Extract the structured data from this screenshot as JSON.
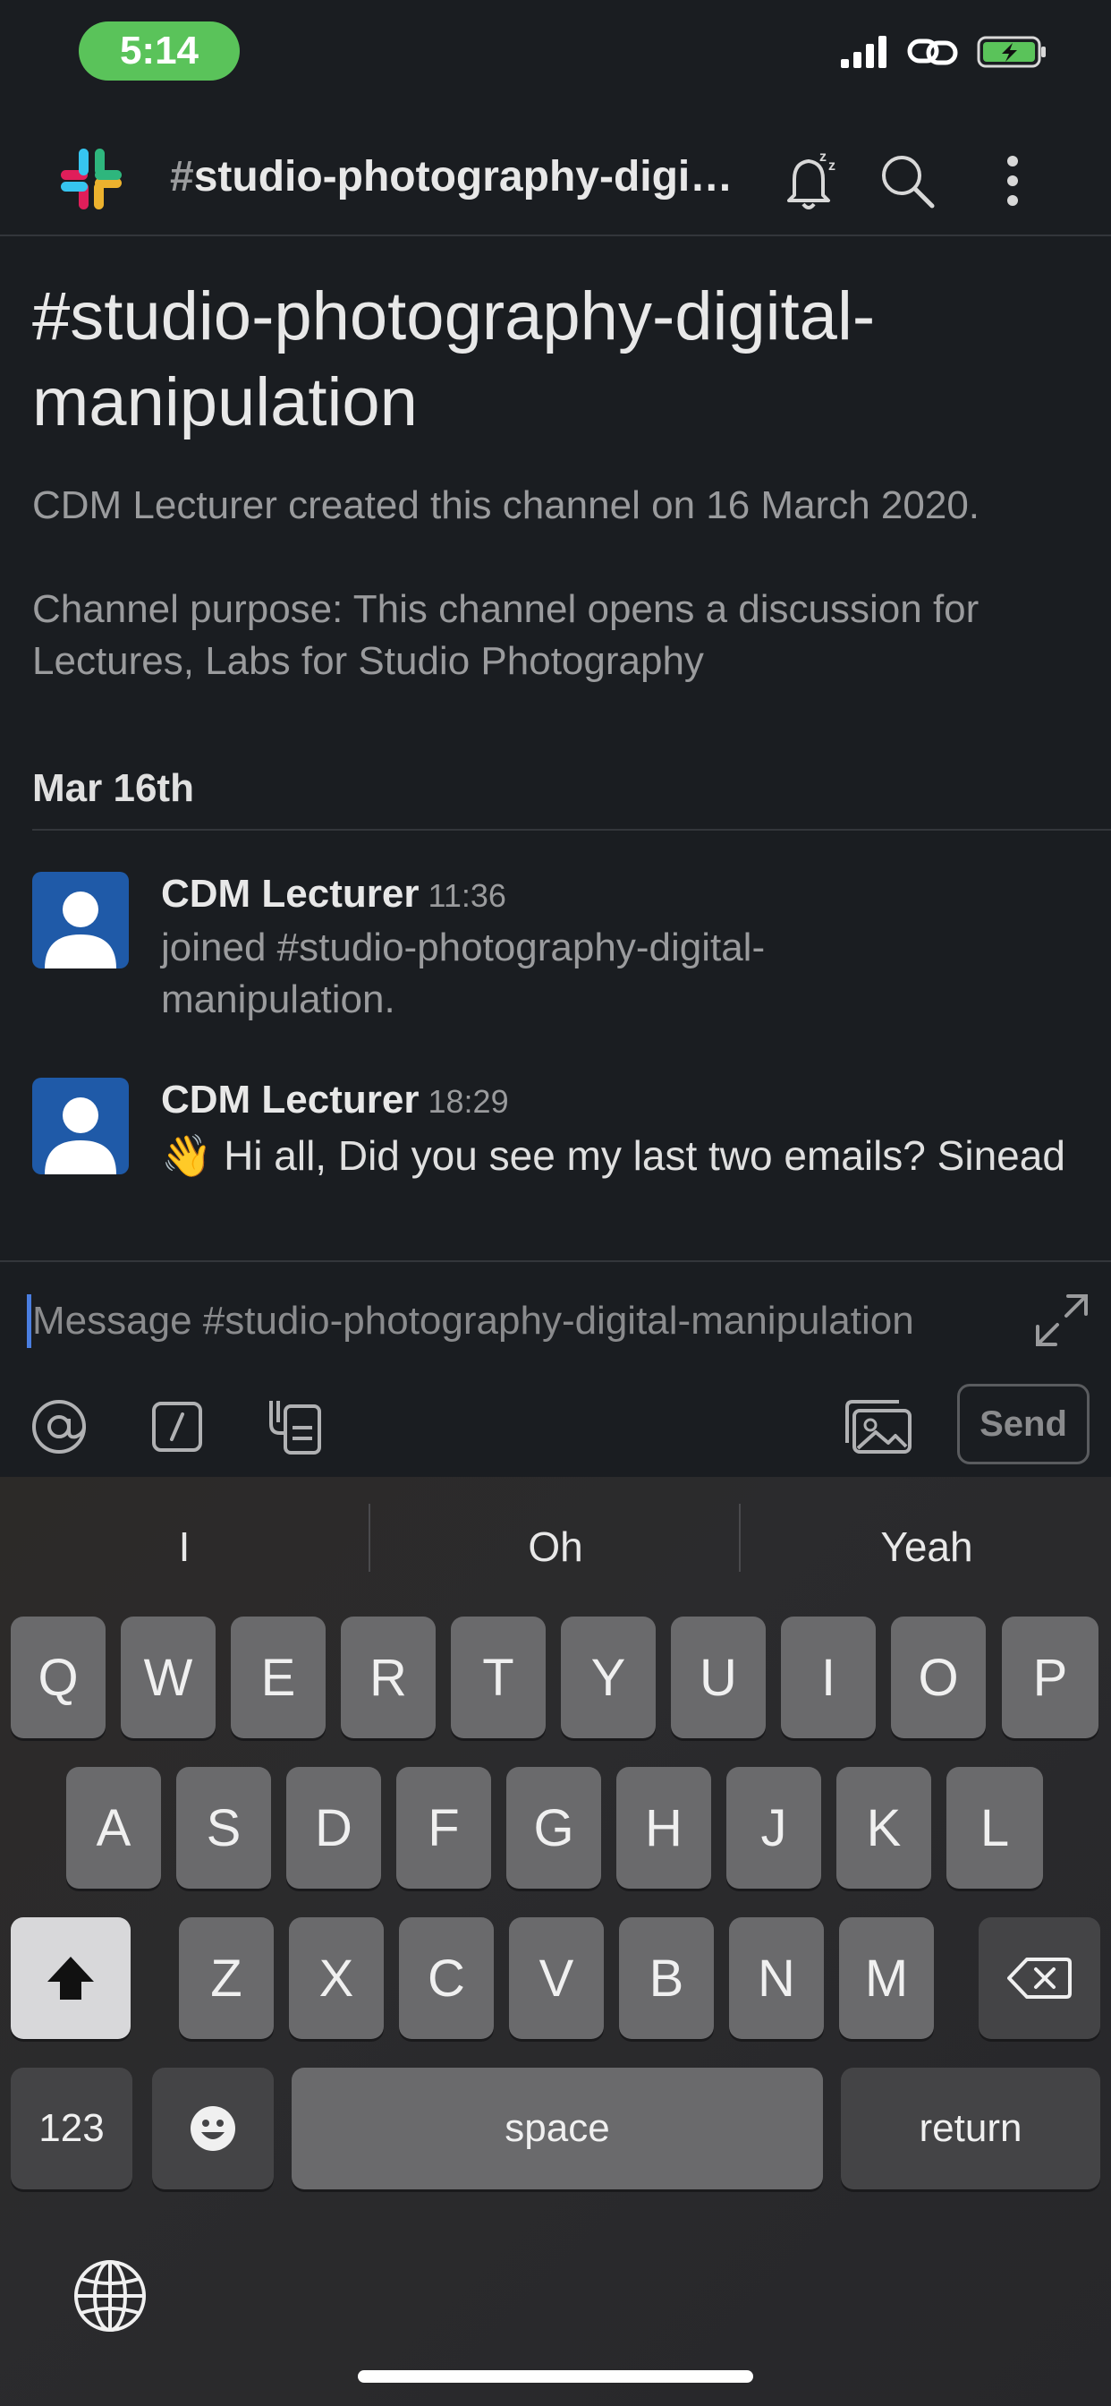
{
  "status_bar": {
    "time": "5:14"
  },
  "header": {
    "hash": "#",
    "channel": "studio-photography-digi…"
  },
  "channel_intro": {
    "name_line1": "#studio-photography-digital-",
    "name_line2": "manipulation",
    "created": "CDM Lecturer created this channel on 16 March 2020.",
    "purpose_line1": "Channel purpose: This channel opens a discussion for",
    "purpose_line2": "Lectures, Labs for Studio Photography"
  },
  "date_divider": "Mar 16th",
  "messages": [
    {
      "author": "CDM Lecturer",
      "time": "11:36",
      "text_line1": "joined #studio-photography-digital-",
      "text_line2": "manipulation."
    },
    {
      "author": "CDM Lecturer",
      "time": "18:29",
      "emoji": "👋",
      "text": "Hi all, Did you see my last two emails? Sinead"
    }
  ],
  "composer": {
    "placeholder": "Message #studio-photography-digital-manipulation",
    "send_label": "Send",
    "at_label": "@",
    "slash_label": "/"
  },
  "keyboard": {
    "suggestions": [
      "I",
      "Oh",
      "Yeah"
    ],
    "row1": [
      "Q",
      "W",
      "E",
      "R",
      "T",
      "Y",
      "U",
      "I",
      "O",
      "P"
    ],
    "row2": [
      "A",
      "S",
      "D",
      "F",
      "G",
      "H",
      "J",
      "K",
      "L"
    ],
    "row3": [
      "Z",
      "X",
      "C",
      "V",
      "B",
      "N",
      "M"
    ],
    "numbers_label": "123",
    "space_label": "space",
    "return_label": "return"
  },
  "colors": {
    "background": "#1a1d21",
    "time_pill": "#5ac35a",
    "avatar": "#1f5aa8",
    "cursor": "#4a7ee0"
  }
}
